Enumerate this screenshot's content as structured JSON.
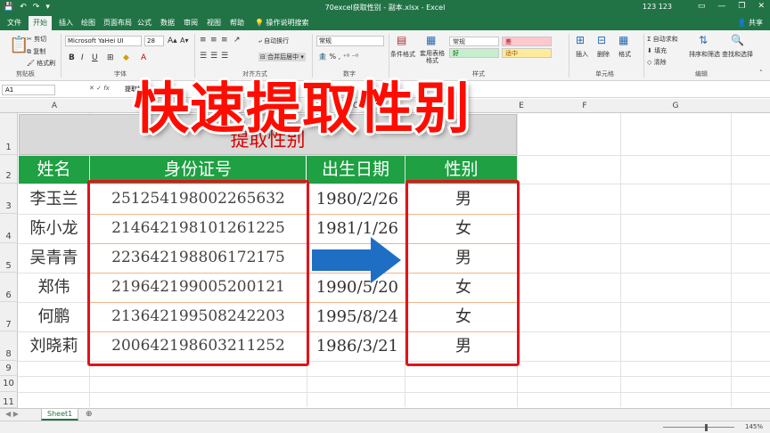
{
  "titlebar": {
    "title": "70excel获取性别 - 副本.xlsx - Excel",
    "user": "123 123",
    "qa": [
      "💾",
      "↶",
      "↷",
      "▾"
    ]
  },
  "tabs": [
    "文件",
    "开始",
    "插入",
    "绘图",
    "页面布局",
    "公式",
    "数据",
    "审阅",
    "视图",
    "帮助"
  ],
  "tell_me": "操作说明搜索",
  "share": "共享",
  "ribbon": {
    "clipboard": {
      "cut": "剪切",
      "copy": "复制",
      "format_painter": "格式刷",
      "label": "剪贴板"
    },
    "font": {
      "name": "Microsoft YaHei UI",
      "size": "28",
      "label": "字体",
      "bold": "B",
      "italic": "I",
      "underline": "U"
    },
    "alignment": {
      "wrap": "自动换行",
      "merge": "合并后居中",
      "label": "对齐方式"
    },
    "number": {
      "format": "常规",
      "label": "数字"
    },
    "styles": {
      "conditional": "条件格式",
      "table": "套用表格格式",
      "label": "样式",
      "normal": "常规",
      "bad": "差",
      "good": "好",
      "neutral": "适中"
    },
    "cells": {
      "insert": "插入",
      "delete": "删除",
      "format": "格式",
      "label": "单元格"
    },
    "editing": {
      "autosum": "自动求和",
      "fill": "填充",
      "clear": "清除",
      "sort": "排序和筛选",
      "find": "查找和选择",
      "label": "编辑"
    }
  },
  "formula_bar": {
    "namebox": "A1",
    "fx": "fx",
    "content": "提取性别"
  },
  "columns": [
    "A",
    "B",
    "C",
    "D",
    "E",
    "F",
    "G"
  ],
  "rows": [
    "1",
    "2",
    "3",
    "4",
    "5",
    "6",
    "7",
    "8",
    "9",
    "10",
    "11"
  ],
  "sheet_title": "提取性别",
  "headers": [
    "姓名",
    "身份证号",
    "出生日期",
    "性别"
  ],
  "records": [
    {
      "name": "李玉兰",
      "id": "251254198002265632",
      "date": "1980/2/26",
      "gender": "男"
    },
    {
      "name": "陈小龙",
      "id": "214642198101261225",
      "date": "1981/1/26",
      "gender": "女"
    },
    {
      "name": "吴青青",
      "id": "223642198806172175",
      "date": "",
      "gender": "男"
    },
    {
      "name": "郑伟",
      "id": "219642199005200121",
      "date": "1990/5/20",
      "gender": "女"
    },
    {
      "name": "何鹏",
      "id": "213642199508242203",
      "date": "1995/8/24",
      "gender": "女"
    },
    {
      "name": "刘晓莉",
      "id": "200642198603211252",
      "date": "1986/3/21",
      "gender": "男"
    }
  ],
  "overlay_title": "快速提取性别",
  "sheet_tab": "Sheet1",
  "add_sheet": "⊕",
  "zoom": "145%",
  "colors": {
    "excel_green": "#217346",
    "header_green": "#1fa043",
    "red": "#e0141b",
    "arrow_blue": "#1e6fc4"
  }
}
